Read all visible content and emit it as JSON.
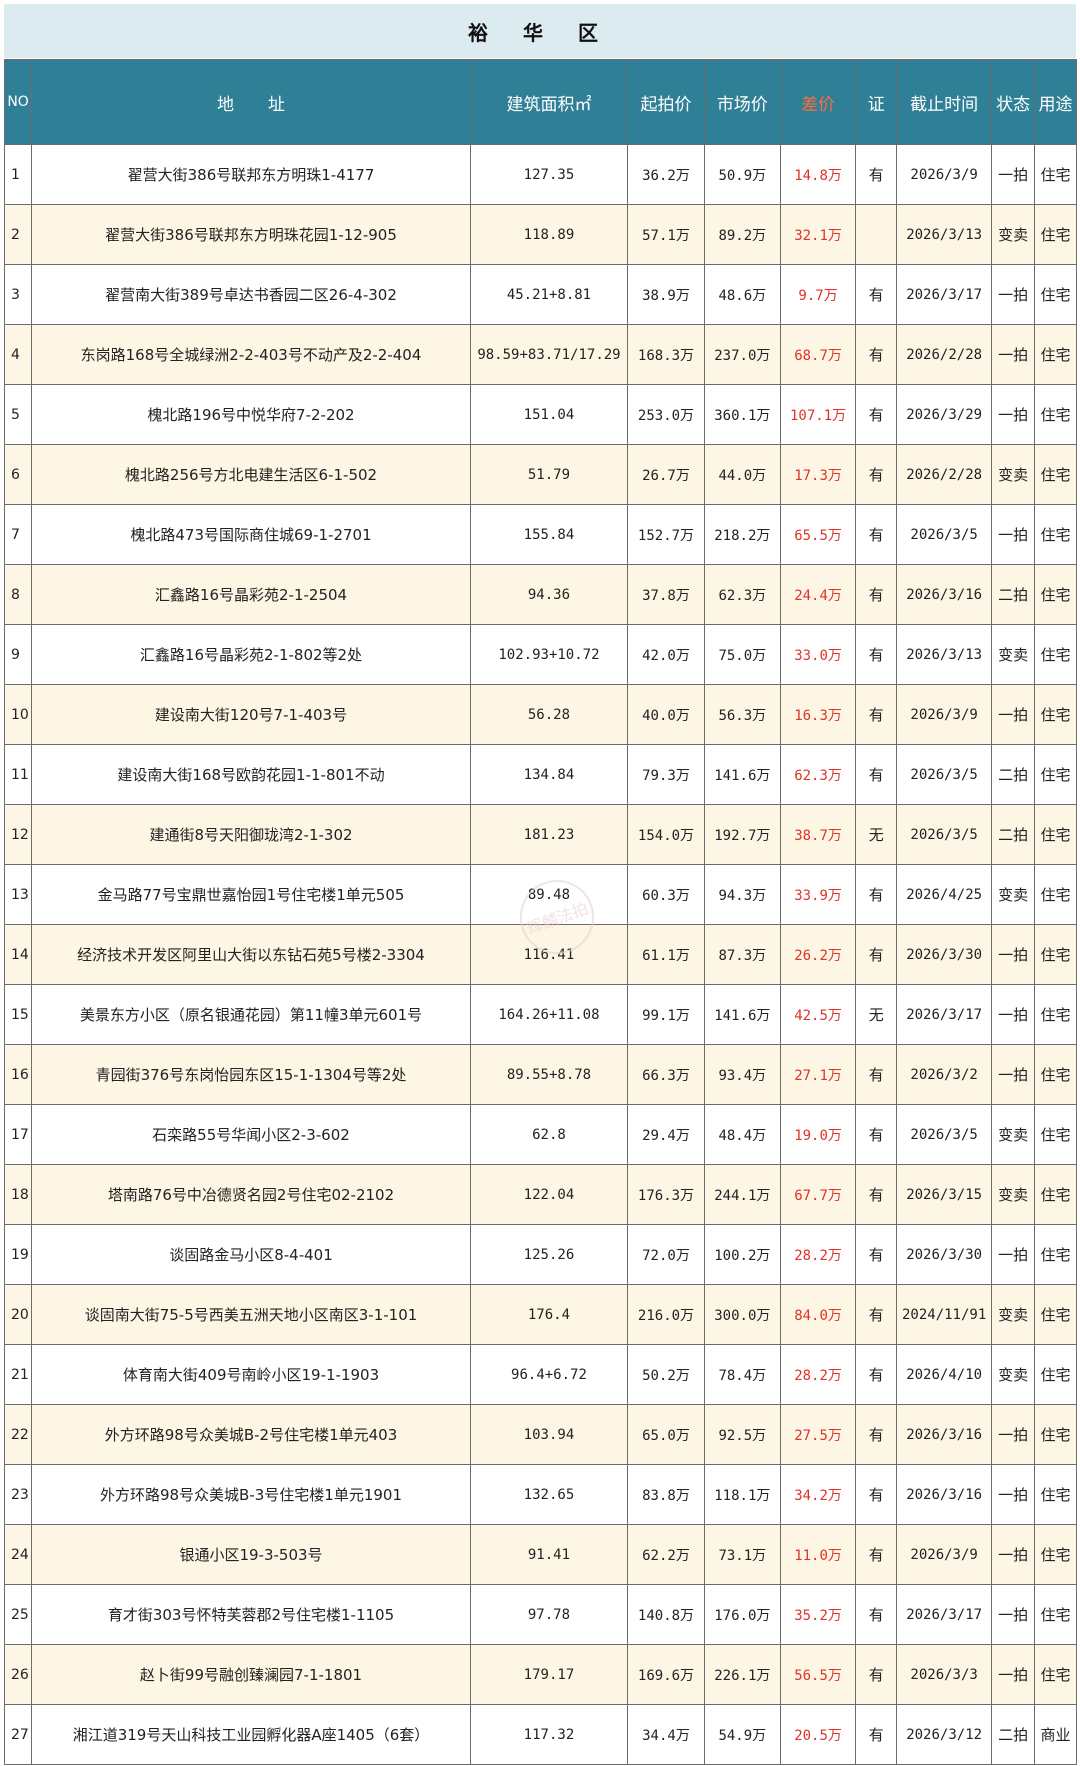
{
  "title": "裕 华 区",
  "watermark": "辉麟法拍",
  "headers": {
    "no": "NO",
    "address": "地　　址",
    "area": "建筑面积㎡",
    "start_price": "起拍价",
    "market_price": "市场价",
    "diff": "差价",
    "cert": "证",
    "deadline": "截止时间",
    "status": "状态",
    "usage": "用途"
  },
  "rows": [
    {
      "no": "1",
      "address": "翟营大街386号联邦东方明珠1-4177",
      "area": "127.35",
      "start": "36.2万",
      "market": "50.9万",
      "diff": "14.8万",
      "cert": "有",
      "deadline": "2026/3/9",
      "status": "一拍",
      "usage": "住宅"
    },
    {
      "no": "2",
      "address": "翟营大街386号联邦东方明珠花园1-12-905",
      "area": "118.89",
      "start": "57.1万",
      "market": "89.2万",
      "diff": "32.1万",
      "cert": "",
      "deadline": "2026/3/13",
      "status": "变卖",
      "usage": "住宅"
    },
    {
      "no": "3",
      "address": "翟营南大街389号卓达书香园二区26-4-302",
      "area": "45.21+8.81",
      "start": "38.9万",
      "market": "48.6万",
      "diff": "9.7万",
      "cert": "有",
      "deadline": "2026/3/17",
      "status": "一拍",
      "usage": "住宅"
    },
    {
      "no": "4",
      "address": "东岗路168号全城绿洲2-2-403号不动产及2-2-404",
      "area": "98.59+83.71/17.29",
      "start": "168.3万",
      "market": "237.0万",
      "diff": "68.7万",
      "cert": "有",
      "deadline": "2026/2/28",
      "status": "一拍",
      "usage": "住宅"
    },
    {
      "no": "5",
      "address": "槐北路196号中悦华府7-2-202",
      "area": "151.04",
      "start": "253.0万",
      "market": "360.1万",
      "diff": "107.1万",
      "cert": "有",
      "deadline": "2026/3/29",
      "status": "一拍",
      "usage": "住宅"
    },
    {
      "no": "6",
      "address": "槐北路256号方北电建生活区6-1-502",
      "area": "51.79",
      "start": "26.7万",
      "market": "44.0万",
      "diff": "17.3万",
      "cert": "有",
      "deadline": "2026/2/28",
      "status": "变卖",
      "usage": "住宅"
    },
    {
      "no": "7",
      "address": "槐北路473号国际商住城69-1-2701",
      "area": "155.84",
      "start": "152.7万",
      "market": "218.2万",
      "diff": "65.5万",
      "cert": "有",
      "deadline": "2026/3/5",
      "status": "一拍",
      "usage": "住宅"
    },
    {
      "no": "8",
      "address": "汇鑫路16号晶彩苑2-1-2504",
      "area": "94.36",
      "start": "37.8万",
      "market": "62.3万",
      "diff": "24.4万",
      "cert": "有",
      "deadline": "2026/3/16",
      "status": "二拍",
      "usage": "住宅"
    },
    {
      "no": "9",
      "address": "汇鑫路16号晶彩苑2-1-802等2处",
      "area": "102.93+10.72",
      "start": "42.0万",
      "market": "75.0万",
      "diff": "33.0万",
      "cert": "有",
      "deadline": "2026/3/13",
      "status": "变卖",
      "usage": "住宅"
    },
    {
      "no": "10",
      "address": "建设南大街120号7-1-403号",
      "area": "56.28",
      "start": "40.0万",
      "market": "56.3万",
      "diff": "16.3万",
      "cert": "有",
      "deadline": "2026/3/9",
      "status": "一拍",
      "usage": "住宅"
    },
    {
      "no": "11",
      "address": "建设南大街168号欧韵花园1-1-801不动",
      "area": "134.84",
      "start": "79.3万",
      "market": "141.6万",
      "diff": "62.3万",
      "cert": "有",
      "deadline": "2026/3/5",
      "status": "二拍",
      "usage": "住宅"
    },
    {
      "no": "12",
      "address": "建通街8号天阳御珑湾2-1-302",
      "area": "181.23",
      "start": "154.0万",
      "market": "192.7万",
      "diff": "38.7万",
      "cert": "无",
      "deadline": "2026/3/5",
      "status": "二拍",
      "usage": "住宅"
    },
    {
      "no": "13",
      "address": "金马路77号宝鼎世嘉怡园1号住宅楼1单元505",
      "area": "89.48",
      "start": "60.3万",
      "market": "94.3万",
      "diff": "33.9万",
      "cert": "有",
      "deadline": "2026/4/25",
      "status": "变卖",
      "usage": "住宅"
    },
    {
      "no": "14",
      "address": "经济技术开发区阿里山大街以东钻石苑5号楼2-3304",
      "area": "116.41",
      "start": "61.1万",
      "market": "87.3万",
      "diff": "26.2万",
      "cert": "有",
      "deadline": "2026/3/30",
      "status": "一拍",
      "usage": "住宅"
    },
    {
      "no": "15",
      "address": "美景东方小区（原名银通花园）第11幢3单元601号",
      "area": "164.26+11.08",
      "start": "99.1万",
      "market": "141.6万",
      "diff": "42.5万",
      "cert": "无",
      "deadline": "2026/3/17",
      "status": "一拍",
      "usage": "住宅"
    },
    {
      "no": "16",
      "address": "青园街376号东岗怡园东区15-1-1304号等2处",
      "area": "89.55+8.78",
      "start": "66.3万",
      "market": "93.4万",
      "diff": "27.1万",
      "cert": "有",
      "deadline": "2026/3/2",
      "status": "一拍",
      "usage": "住宅"
    },
    {
      "no": "17",
      "address": "石栾路55号华闻小区2-3-602",
      "area": "62.8",
      "start": "29.4万",
      "market": "48.4万",
      "diff": "19.0万",
      "cert": "有",
      "deadline": "2026/3/5",
      "status": "变卖",
      "usage": "住宅"
    },
    {
      "no": "18",
      "address": "塔南路76号中冶德贤名园2号住宅02-2102",
      "area": "122.04",
      "start": "176.3万",
      "market": "244.1万",
      "diff": "67.7万",
      "cert": "有",
      "deadline": "2026/3/15",
      "status": "变卖",
      "usage": "住宅"
    },
    {
      "no": "19",
      "address": "谈固路金马小区8-4-401",
      "area": "125.26",
      "start": "72.0万",
      "market": "100.2万",
      "diff": "28.2万",
      "cert": "有",
      "deadline": "2026/3/30",
      "status": "一拍",
      "usage": "住宅"
    },
    {
      "no": "20",
      "address": "谈固南大街75-5号西美五洲天地小区南区3-1-101",
      "area": "176.4",
      "start": "216.0万",
      "market": "300.0万",
      "diff": "84.0万",
      "cert": "有",
      "deadline": "2024/11/91",
      "status": "变卖",
      "usage": "住宅"
    },
    {
      "no": "21",
      "address": "体育南大街409号南岭小区19-1-1903",
      "area": "96.4+6.72",
      "start": "50.2万",
      "market": "78.4万",
      "diff": "28.2万",
      "cert": "有",
      "deadline": "2026/4/10",
      "status": "变卖",
      "usage": "住宅"
    },
    {
      "no": "22",
      "address": "外方环路98号众美城B-2号住宅楼1单元403",
      "area": "103.94",
      "start": "65.0万",
      "market": "92.5万",
      "diff": "27.5万",
      "cert": "有",
      "deadline": "2026/3/16",
      "status": "一拍",
      "usage": "住宅"
    },
    {
      "no": "23",
      "address": "外方环路98号众美城B-3号住宅楼1单元1901",
      "area": "132.65",
      "start": "83.8万",
      "market": "118.1万",
      "diff": "34.2万",
      "cert": "有",
      "deadline": "2026/3/16",
      "status": "一拍",
      "usage": "住宅"
    },
    {
      "no": "24",
      "address": "银通小区19-3-503号",
      "area": "91.41",
      "start": "62.2万",
      "market": "73.1万",
      "diff": "11.0万",
      "cert": "有",
      "deadline": "2026/3/9",
      "status": "一拍",
      "usage": "住宅"
    },
    {
      "no": "25",
      "address": "育才街303号怀特芙蓉郡2号住宅楼1-1105",
      "area": "97.78",
      "start": "140.8万",
      "market": "176.0万",
      "diff": "35.2万",
      "cert": "有",
      "deadline": "2026/3/17",
      "status": "一拍",
      "usage": "住宅"
    },
    {
      "no": "26",
      "address": "赵卜街99号融创臻澜园7-1-1801",
      "area": "179.17",
      "start": "169.6万",
      "market": "226.1万",
      "diff": "56.5万",
      "cert": "有",
      "deadline": "2026/3/3",
      "status": "一拍",
      "usage": "住宅"
    },
    {
      "no": "27",
      "address": "湘江道319号天山科技工业园孵化器A座1405（6套）",
      "area": "117.32",
      "start": "34.4万",
      "market": "54.9万",
      "diff": "20.5万",
      "cert": "有",
      "deadline": "2026/3/12",
      "status": "二拍",
      "usage": "商业"
    }
  ]
}
